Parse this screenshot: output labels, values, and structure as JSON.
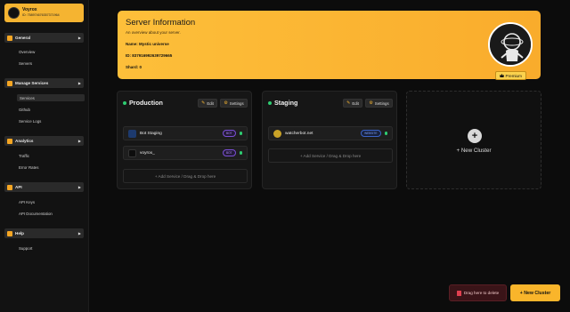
{
  "user": {
    "name": "Voyrox",
    "id": "ID: 758974676357371964"
  },
  "sidebar": {
    "sections": [
      {
        "label": "General",
        "items": [
          "Overview",
          "Servers"
        ]
      },
      {
        "label": "Manage Services",
        "items": [
          "Services",
          "Github",
          "Service Logs"
        ]
      },
      {
        "label": "Analytics",
        "items": [
          "Traffic",
          "Error Rates"
        ]
      },
      {
        "label": "API",
        "items": [
          "API Keys",
          "API Documentation"
        ]
      },
      {
        "label": "Help",
        "items": [
          "Support"
        ]
      }
    ],
    "active_item": "Services",
    "arrow": "▶"
  },
  "server": {
    "title": "Server Information",
    "subtitle": "An overview about your server.",
    "name_label": "Name:",
    "name_value": "Mystic universe",
    "id_label": "ID:",
    "id_value": "837916992639729665",
    "shard_label": "Shard:",
    "shard_value": "0",
    "premium_label": "Premium"
  },
  "clusters": [
    {
      "title": "Production",
      "edit_label": "Edit",
      "settings_label": "Settings",
      "services": [
        {
          "name": "Bot Staging",
          "badge": "BOT"
        },
        {
          "name": "voyrox_",
          "badge": "BOT"
        }
      ],
      "add_label": "+ Add Service / Drag & Drop here"
    },
    {
      "title": "Staging",
      "edit_label": "Edit",
      "settings_label": "Settings",
      "services": [
        {
          "name": "watcherbot.net",
          "badge": "WEBSITE"
        }
      ],
      "add_label": "+ Add Service / Drag & Drop here"
    }
  ],
  "new_cluster_card": {
    "icon": "+",
    "label": "+ New Cluster"
  },
  "actions": {
    "drag_delete": "Drag here to delete",
    "new_cluster": "+ New Cluster"
  },
  "colors": {
    "accent": "#f9b52b",
    "status_online": "#2ecc71",
    "danger": "#3a1418"
  }
}
